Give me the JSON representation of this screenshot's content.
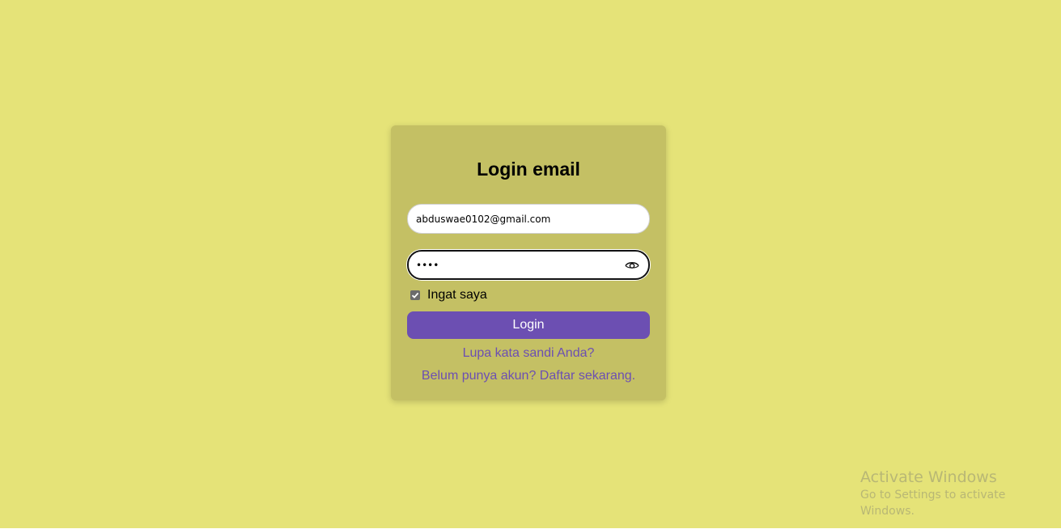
{
  "login": {
    "title": "Login email",
    "email_value": "abduswae0102@gmail.com",
    "password_value": "••••",
    "remember_label": "Ingat saya",
    "remember_checked": true,
    "login_button": "Login",
    "forgot_link": "Lupa kata sandi Anda?",
    "register_link": "Belum punya akun? Daftar sekarang."
  },
  "icons": {
    "password_toggle": "eye-icon",
    "checkbox": "check-icon"
  },
  "watermark": {
    "line1": "Activate Windows",
    "line2": "Go to Settings to activate Windows."
  },
  "colors": {
    "background": "#e5e378",
    "card": "#c4c064",
    "accent": "#6c4fb2"
  }
}
